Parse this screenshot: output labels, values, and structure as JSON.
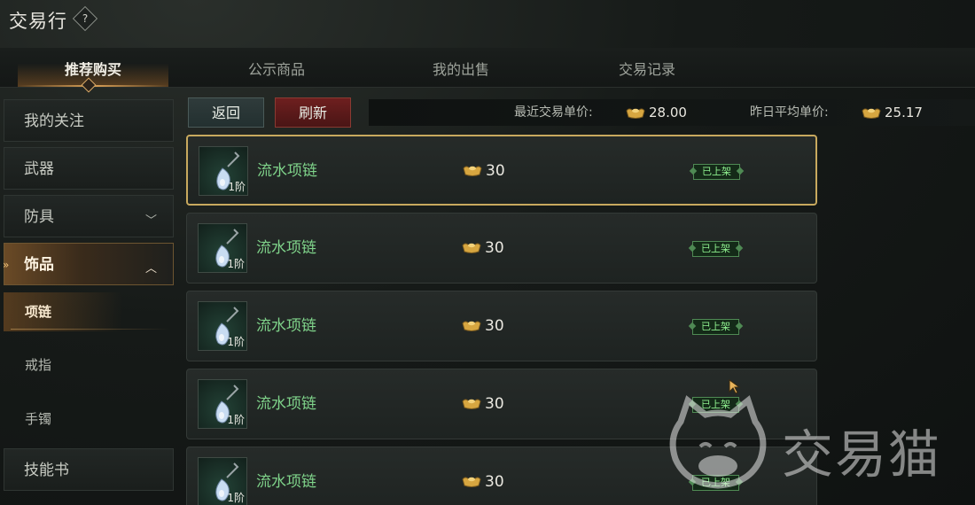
{
  "header": {
    "title": "交易行",
    "help_icon": "?"
  },
  "tabs": [
    {
      "label": "推荐购买",
      "active": true
    },
    {
      "label": "公示商品",
      "active": false
    },
    {
      "label": "我的出售",
      "active": false
    },
    {
      "label": "交易记录",
      "active": false
    }
  ],
  "sidebar": {
    "items": [
      {
        "label": "我的关注"
      },
      {
        "label": "武器"
      },
      {
        "label": "防具"
      },
      {
        "label": "饰品"
      },
      {
        "label": "技能书"
      }
    ],
    "sub_items": [
      {
        "label": "项链"
      },
      {
        "label": "戒指"
      },
      {
        "label": "手镯"
      }
    ]
  },
  "toolbar": {
    "back_label": "返回",
    "refresh_label": "刷新",
    "recent_price_label": "最近交易单价:",
    "recent_price_value": "28.00",
    "avg_price_label": "昨日平均单价:",
    "avg_price_value": "25.17"
  },
  "listings": [
    {
      "name": "流水项链",
      "tier": "1阶",
      "price": "30",
      "status": "已上架"
    },
    {
      "name": "流水项链",
      "tier": "1阶",
      "price": "30",
      "status": "已上架"
    },
    {
      "name": "流水项链",
      "tier": "1阶",
      "price": "30",
      "status": "已上架"
    },
    {
      "name": "流水项链",
      "tier": "1阶",
      "price": "30",
      "status": "已上架"
    },
    {
      "name": "流水项链",
      "tier": "1阶",
      "price": "30",
      "status": "已上架"
    }
  ],
  "watermark": {
    "text": "交易猫"
  },
  "colors": {
    "accent_gold": "#c8a95e",
    "item_name": "#7fd38a",
    "status_green": "#8ff08f",
    "refresh_red": "#6e1f1f"
  }
}
